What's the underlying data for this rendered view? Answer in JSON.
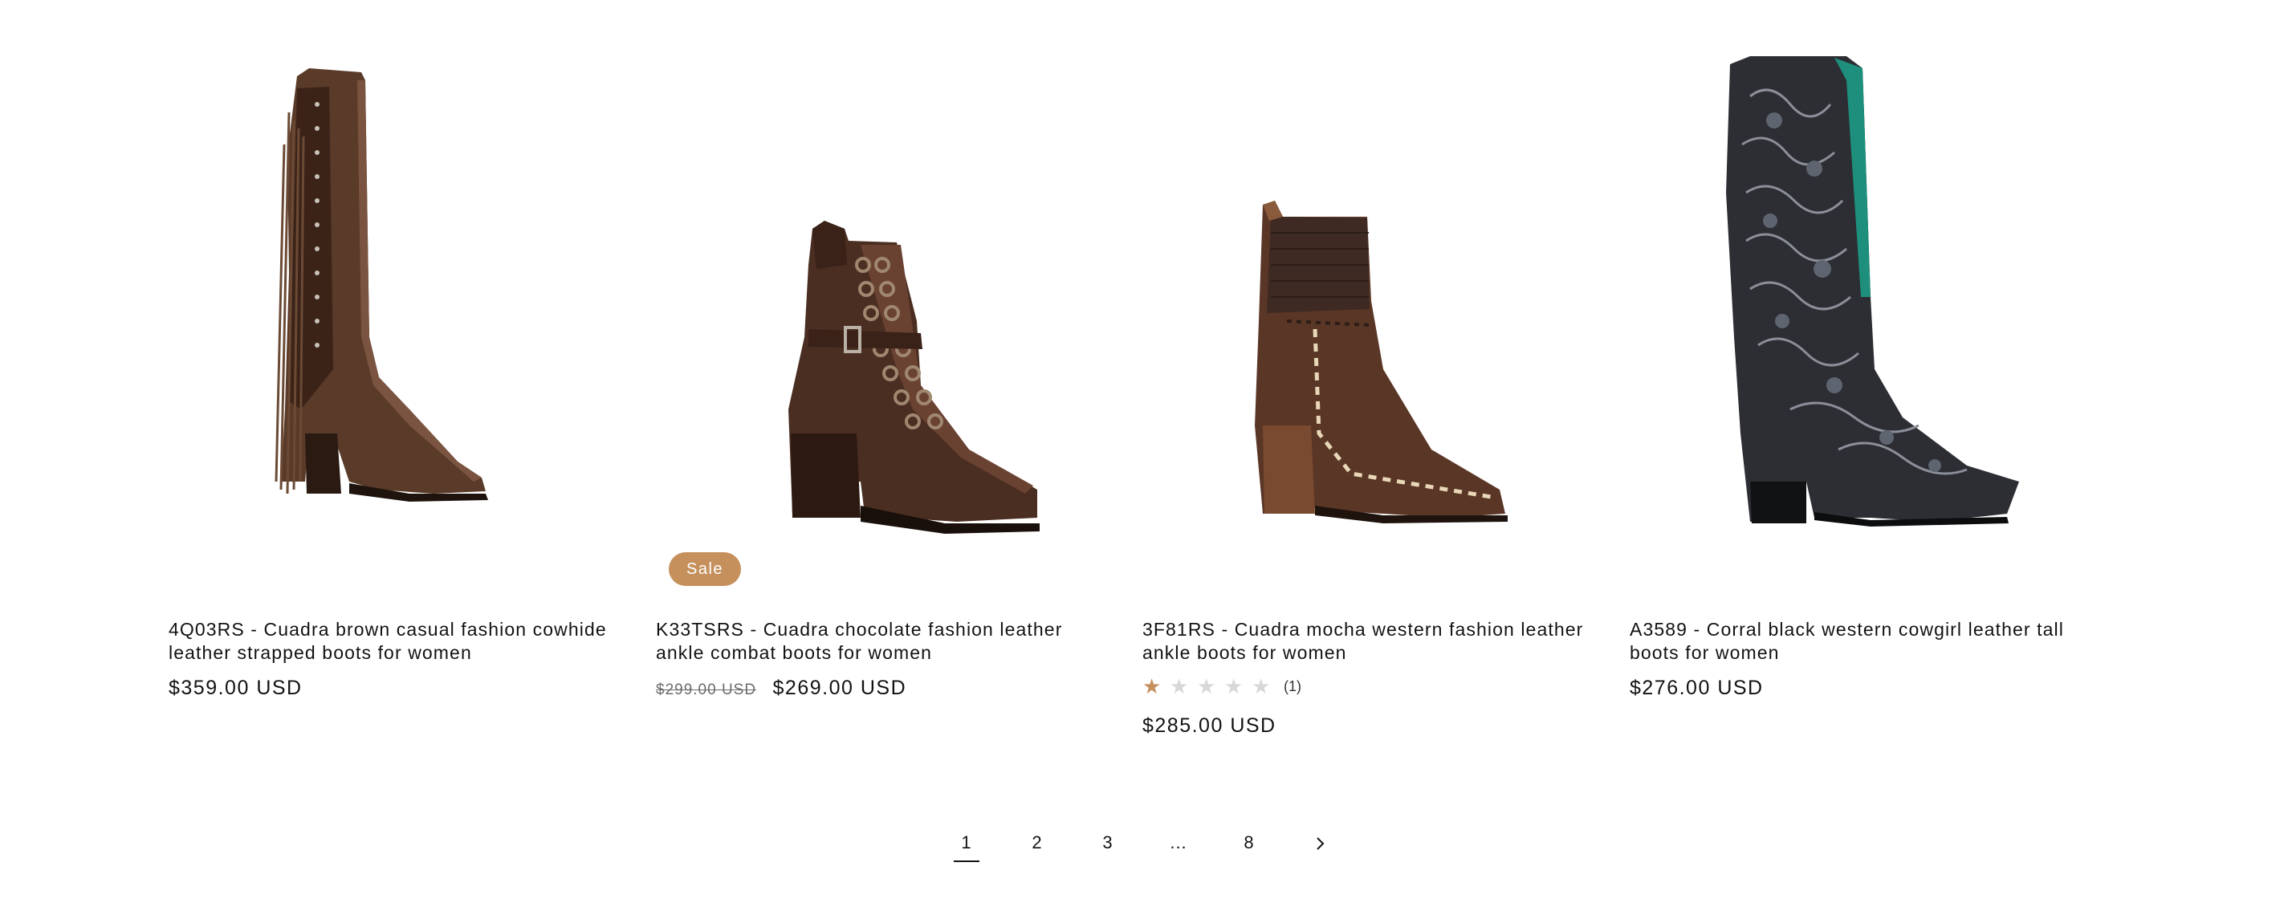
{
  "products": [
    {
      "title": "4Q03RS - Cuadra brown casual fashion cowhide leather strapped boots for women",
      "price": "$359.00 USD",
      "image_icon": "brown-fringe-tall-boot"
    },
    {
      "title": "K33TSRS - Cuadra chocolate fashion leather ankle combat boots for women",
      "badge": "Sale",
      "compare_price": "$299.00 USD",
      "price": "$269.00 USD",
      "image_icon": "chocolate-lace-up-ankle-boot"
    },
    {
      "title": "3F81RS - Cuadra mocha western fashion leather ankle boots for women",
      "rating": {
        "value": 1,
        "max": 5,
        "count_text": "(1)"
      },
      "price": "$285.00 USD",
      "image_icon": "mocha-western-ankle-boot"
    },
    {
      "title": "A3589 - Corral black western cowgirl leather tall boots for women",
      "price": "$276.00 USD",
      "image_icon": "black-inlay-cowgirl-boot"
    }
  ],
  "pagination": {
    "pages": [
      "1",
      "2",
      "3",
      "...",
      "8"
    ],
    "current": "1",
    "next_icon": "chevron-right-icon"
  },
  "colors": {
    "sale_badge": "#c5905c",
    "star_filled": "#c5905c",
    "star_empty": "#d8d8d8",
    "text": "#121212"
  }
}
